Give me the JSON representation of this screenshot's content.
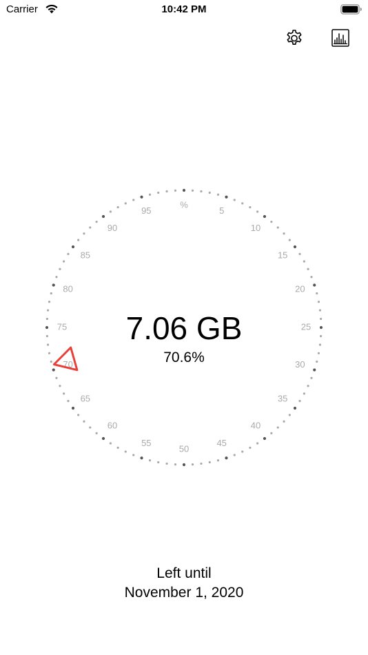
{
  "status_bar": {
    "carrier": "Carrier",
    "time": "10:42 PM",
    "wifi_icon": "wifi-icon",
    "battery_icon": "battery-full-icon"
  },
  "toolbar": {
    "settings_icon": "gear-icon",
    "stats_icon": "bar-chart-icon"
  },
  "dial": {
    "center_label": "%",
    "tick_labels": [
      "5",
      "10",
      "15",
      "20",
      "25",
      "30",
      "35",
      "40",
      "45",
      "50",
      "55",
      "60",
      "65",
      "70",
      "75",
      "80",
      "85",
      "90",
      "95"
    ],
    "pointer_percent": 70.6,
    "pointer_color": "#e8413a",
    "dot_color": "#a9a9a9",
    "major_dot_color": "#555555",
    "label_color": "#aaaaaa"
  },
  "usage": {
    "value": "7.06 GB",
    "percent": "70.6%"
  },
  "footer": {
    "line1": "Left until",
    "line2": "November 1, 2020"
  }
}
